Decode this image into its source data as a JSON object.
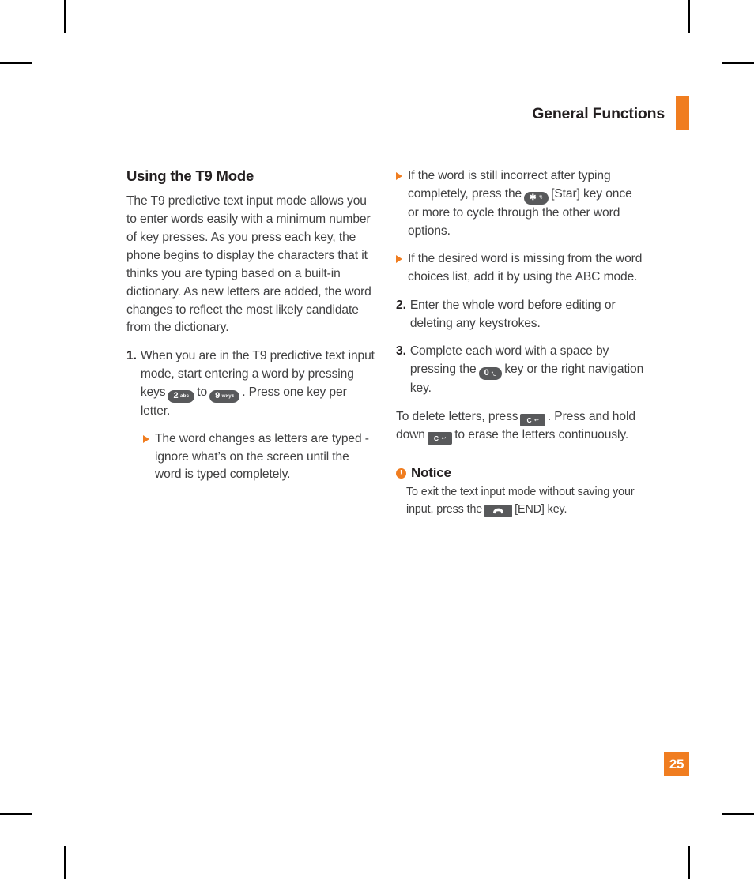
{
  "header": {
    "title": "General Functions",
    "accent_color": "#f07d20"
  },
  "page_number": "25",
  "left_column": {
    "section_title": "Using the T9 Mode",
    "intro_paragraph": "The T9 predictive text input mode allows you to enter words easily with a minimum number of key presses. As you press each key, the phone begins to display the characters that it thinks you are typing based on a built-in dictionary. As new letters are added, the word changes to reflect the most likely candidate from the dictionary.",
    "step1": {
      "number": "1.",
      "text_before_key1": "When you are in the T9 predictive text input mode, start entering a word by pressing keys",
      "key1": {
        "digit": "2",
        "letters": "abc"
      },
      "text_between_keys": "to",
      "key2": {
        "digit": "9",
        "letters": "wxyz"
      },
      "text_after_key2": ". Press one key per letter."
    },
    "step1_bullet": "The word changes as letters are typed - ignore what’s on the screen until the word is typed completely."
  },
  "right_column": {
    "bullet1": {
      "text_before_key": "If the word is still incorrect after typing completely, press the",
      "key": {
        "glyph": "star-key",
        "digit": "✱",
        "symbol": "↯"
      },
      "text_after_key": "[Star] key once or more to cycle through the other word options."
    },
    "bullet2": "If the desired word is missing from the word choices list, add it by using the ABC mode.",
    "step2": {
      "number": "2.",
      "text": "Enter the whole word before editing or deleting any keystrokes."
    },
    "step3": {
      "number": "3.",
      "text_before_key": "Complete each word with a space by pressing the",
      "key": {
        "digit": "0",
        "symbol": "•␣"
      },
      "text_after_key": "key or the right navigation key."
    },
    "delete_paragraph": {
      "text_before_key1": "To delete letters, press",
      "key1": {
        "letter": "C",
        "symbol": "↩"
      },
      "text_between_keys": ". Press and hold down",
      "key2": {
        "letter": "C",
        "symbol": "↩"
      },
      "text_after_key2": "to erase the letters continuously."
    },
    "notice": {
      "icon": "exclamation-icon",
      "title": "Notice",
      "text_before_key": "To exit the text input mode without saving your input, press the",
      "key": {
        "glyph": "end-call-key"
      },
      "text_after_key": "[END] key."
    }
  }
}
